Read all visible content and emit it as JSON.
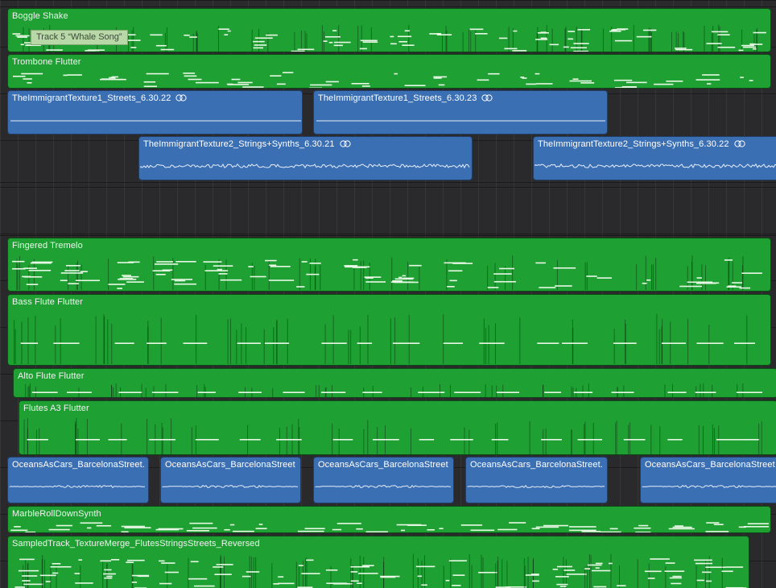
{
  "tooltip": "Track 5 “Whale Song”",
  "colors": {
    "midi_region": "#1ea132",
    "audio_region": "#3b6fb3",
    "background": "#2a2a2c"
  },
  "regions": {
    "boggle_shake": "Boggle Shake",
    "trombone_flutter": "Trombone Flutter",
    "immigrant_streets_22": "TheImmigrantTexture1_Streets_6.30.22",
    "immigrant_streets_23": "TheImmigrantTexture1_Streets_6.30.23",
    "immigrant_strings_21": "TheImmigrantTexture2_Strings+Synths_6.30.21",
    "immigrant_strings_22": "TheImmigrantTexture2_Strings+Synths_6.30.22",
    "fingered_tremelo": "Fingered Tremelo",
    "bass_flute_flutter": "Bass Flute Flutter",
    "alto_flute_flutter": "Alto Flute Flutter",
    "flutes_a3_flutter": "Flutes A3 Flutter",
    "oceans_1": "OceansAsCars_BarcelonaStreet.",
    "oceans_2": "OceansAsCars_BarcelonaStreet",
    "oceans_3": "OceansAsCars_BarcelonaStreet",
    "oceans_4": "OceansAsCars_BarcelonaStreet.",
    "oceans_5": "OceansAsCars_BarcelonaStreet",
    "marble_roll": "MarbleRollDownSynth",
    "sampled_track": "SampledTrack_TextureMerge_FlutesStringsStreets_Reversed"
  }
}
